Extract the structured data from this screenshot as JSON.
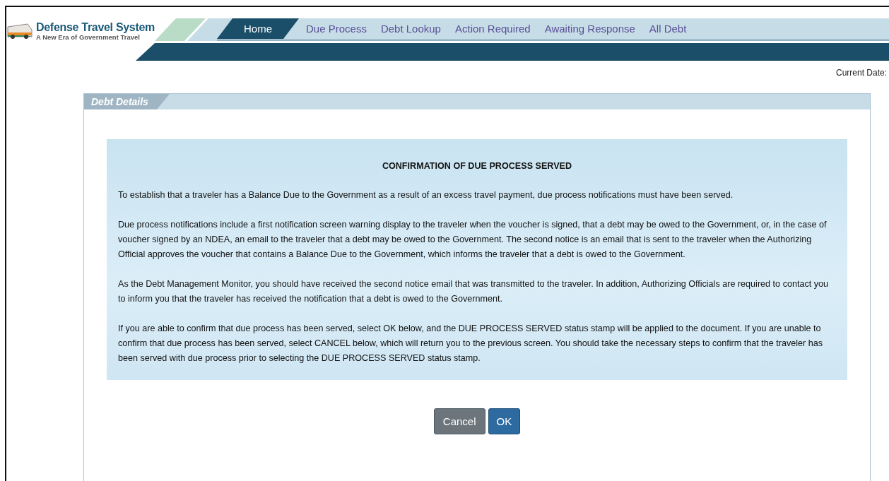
{
  "logo": {
    "title": "Defense Travel System",
    "tagline": "A New Era of Government Travel"
  },
  "nav": [
    {
      "label": "Home",
      "selected": true
    },
    {
      "label": "Due Process",
      "selected": false
    },
    {
      "label": "Debt Lookup",
      "selected": false
    },
    {
      "label": "Action Required",
      "selected": false
    },
    {
      "label": "Awaiting Response",
      "selected": false
    },
    {
      "label": "All Debt",
      "selected": false
    }
  ],
  "current_date_label": "Current Date:",
  "panel": {
    "title": "Debt Details",
    "notice": {
      "heading": "CONFIRMATION OF DUE PROCESS SERVED",
      "paragraphs": [
        "To establish that a traveler has a Balance Due to the Government as a result of an excess travel payment, due process notifications must have been served.",
        "Due process notifications include a first notification screen warning display to the traveler when the voucher is signed, that a debt may be owed to the Government, or, in the case of voucher signed by an NDEA, an email to the traveler that a debt may be owed to the Government. The second notice is an email that is sent to the traveler when the Authorizing Official approves the voucher that contains a Balance Due to the Government, which informs the traveler that a debt is owed to the Government.",
        "As the Debt Management Monitor, you should have received the second notice email that was transmitted to the traveler. In addition, Authorizing Officials are required to contact you to inform you that the traveler has received the notification that a debt is owed to the Government.",
        "If you are able to confirm that due process has been served, select OK below, and the DUE PROCESS SERVED status stamp will be applied to the document. If you are unable to confirm that due process has been served, select CANCEL below, which will return you to the previous screen. You should take the necessary steps to confirm that the traveler has been served with due process prior to selecting the DUE PROCESS SERVED status stamp."
      ]
    },
    "buttons": [
      {
        "label": "Cancel",
        "kind": "secondary"
      },
      {
        "label": "OK",
        "kind": "primary"
      }
    ]
  }
}
